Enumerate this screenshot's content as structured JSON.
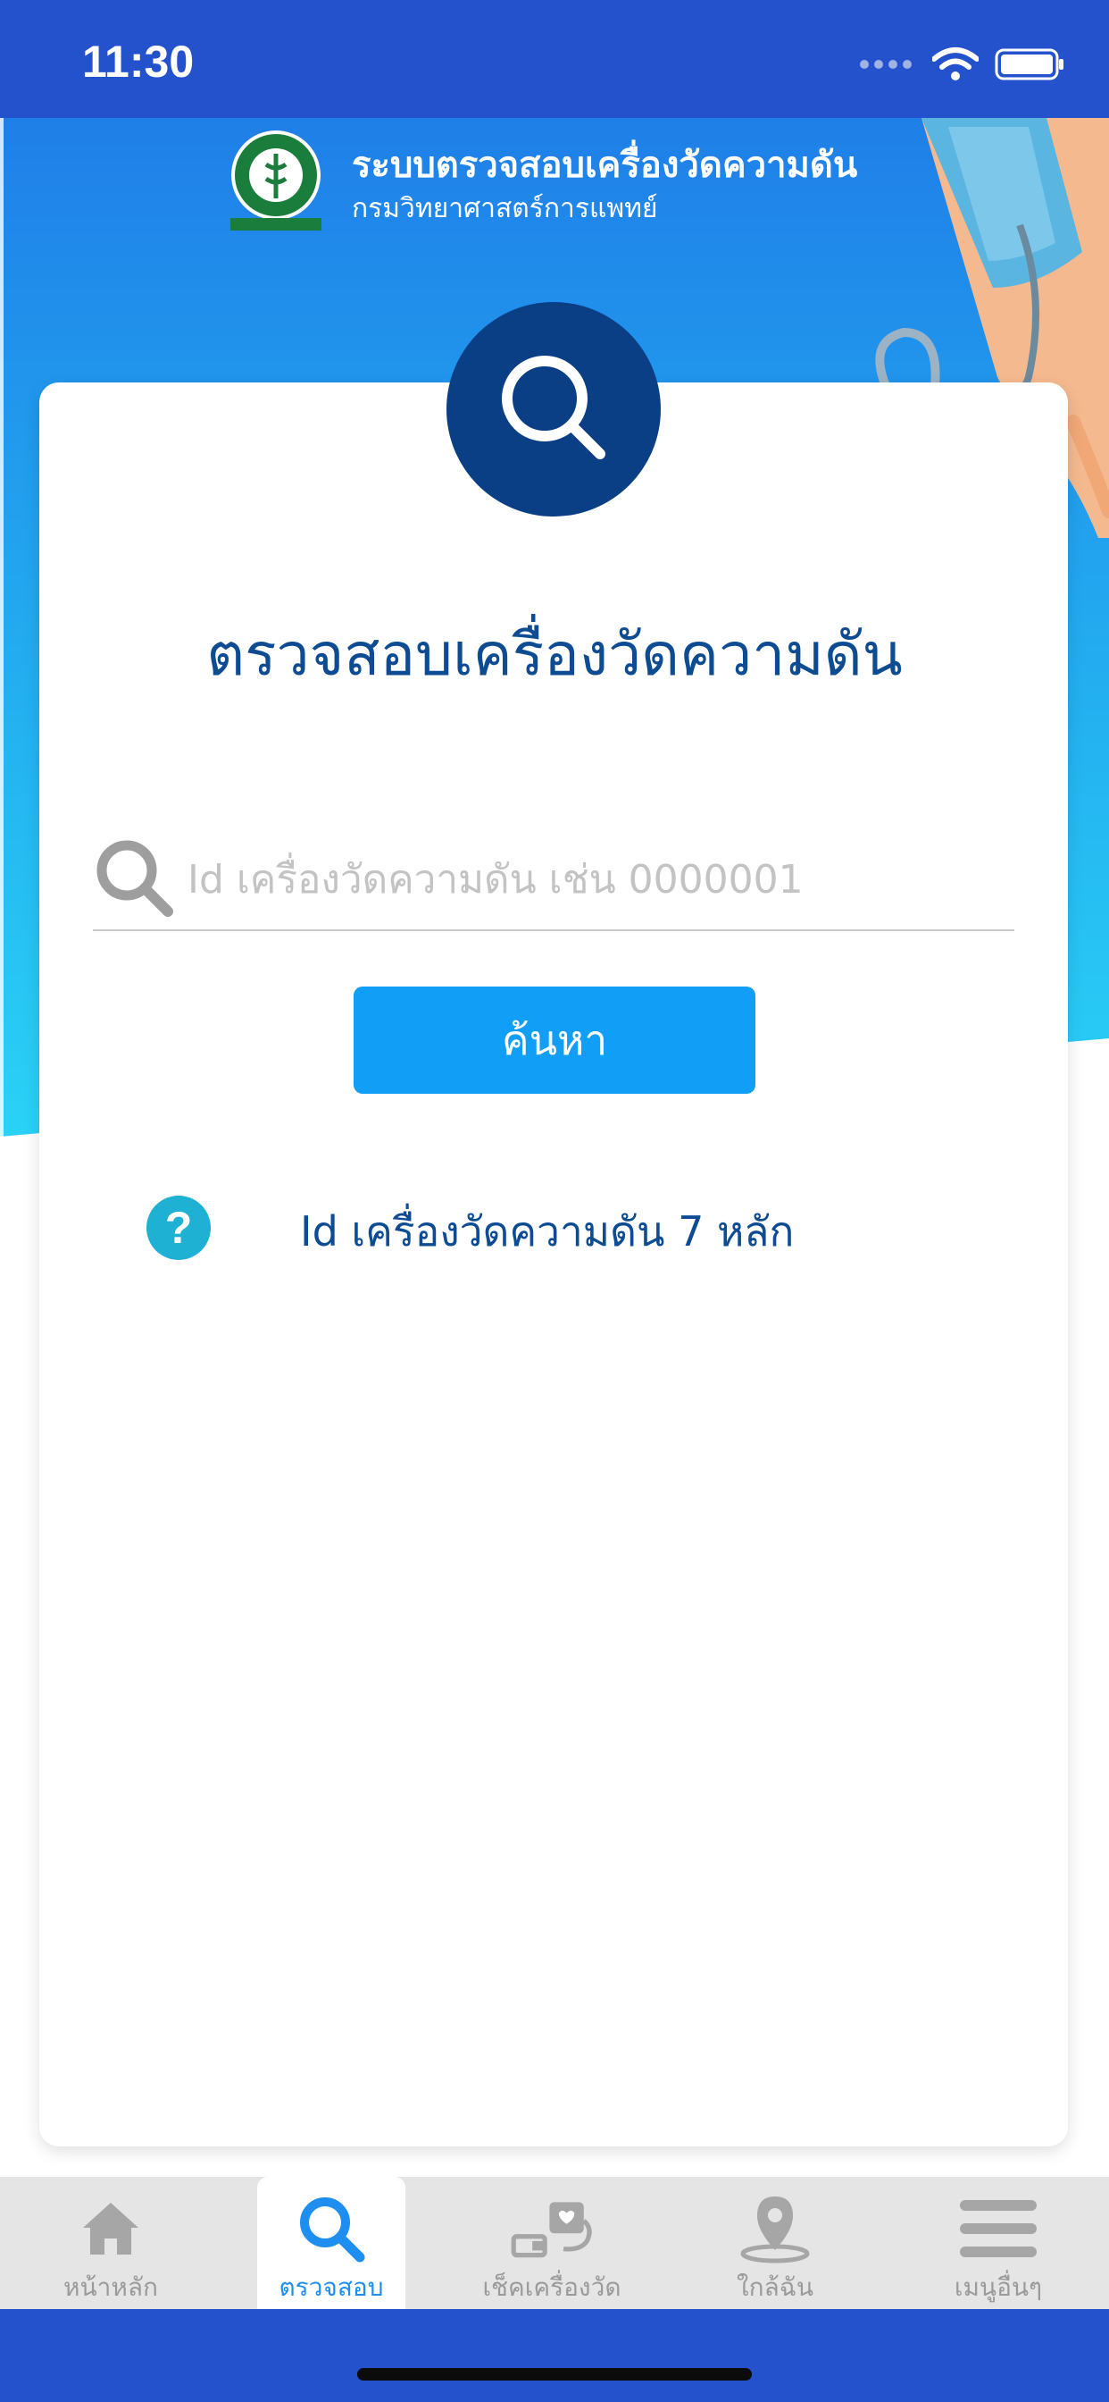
{
  "status_bar": {
    "time": "11:30"
  },
  "header": {
    "title": "ระบบตรวจสอบเครื่องวัดความดัน",
    "subtitle": "กรมวิทยาศาสตร์การแพทย์",
    "logo_icon": "department-seal"
  },
  "card": {
    "title": "ตรวจสอบเครื่องวัดความดัน",
    "search_placeholder": "Id เครื่องวัดความดัน เช่น 0000001",
    "search_value": "",
    "search_button": "ค้นหา",
    "help_text": "Id เครื่องวัดความดัน 7 หลัก",
    "help_icon_symbol": "?"
  },
  "tabs": [
    {
      "label": "หน้าหลัก",
      "icon": "home-icon",
      "active": false
    },
    {
      "label": "ตรวจสอบ",
      "icon": "search-icon",
      "active": true
    },
    {
      "label": "เช็คเครื่องวัด",
      "icon": "blood-pressure-monitor-icon",
      "active": false
    },
    {
      "label": "ใกล้ฉัน",
      "icon": "location-pin-icon",
      "active": false
    },
    {
      "label": "เมนูอื่นๆ",
      "icon": "menu-icon",
      "active": false
    }
  ],
  "colors": {
    "status_bar": "#2452cc",
    "title_blue": "#0d4b92",
    "button": "#119ef7",
    "circle": "#0a3f86",
    "help_icon": "#1fb1d3",
    "tab_active": "#1e8ff0"
  }
}
